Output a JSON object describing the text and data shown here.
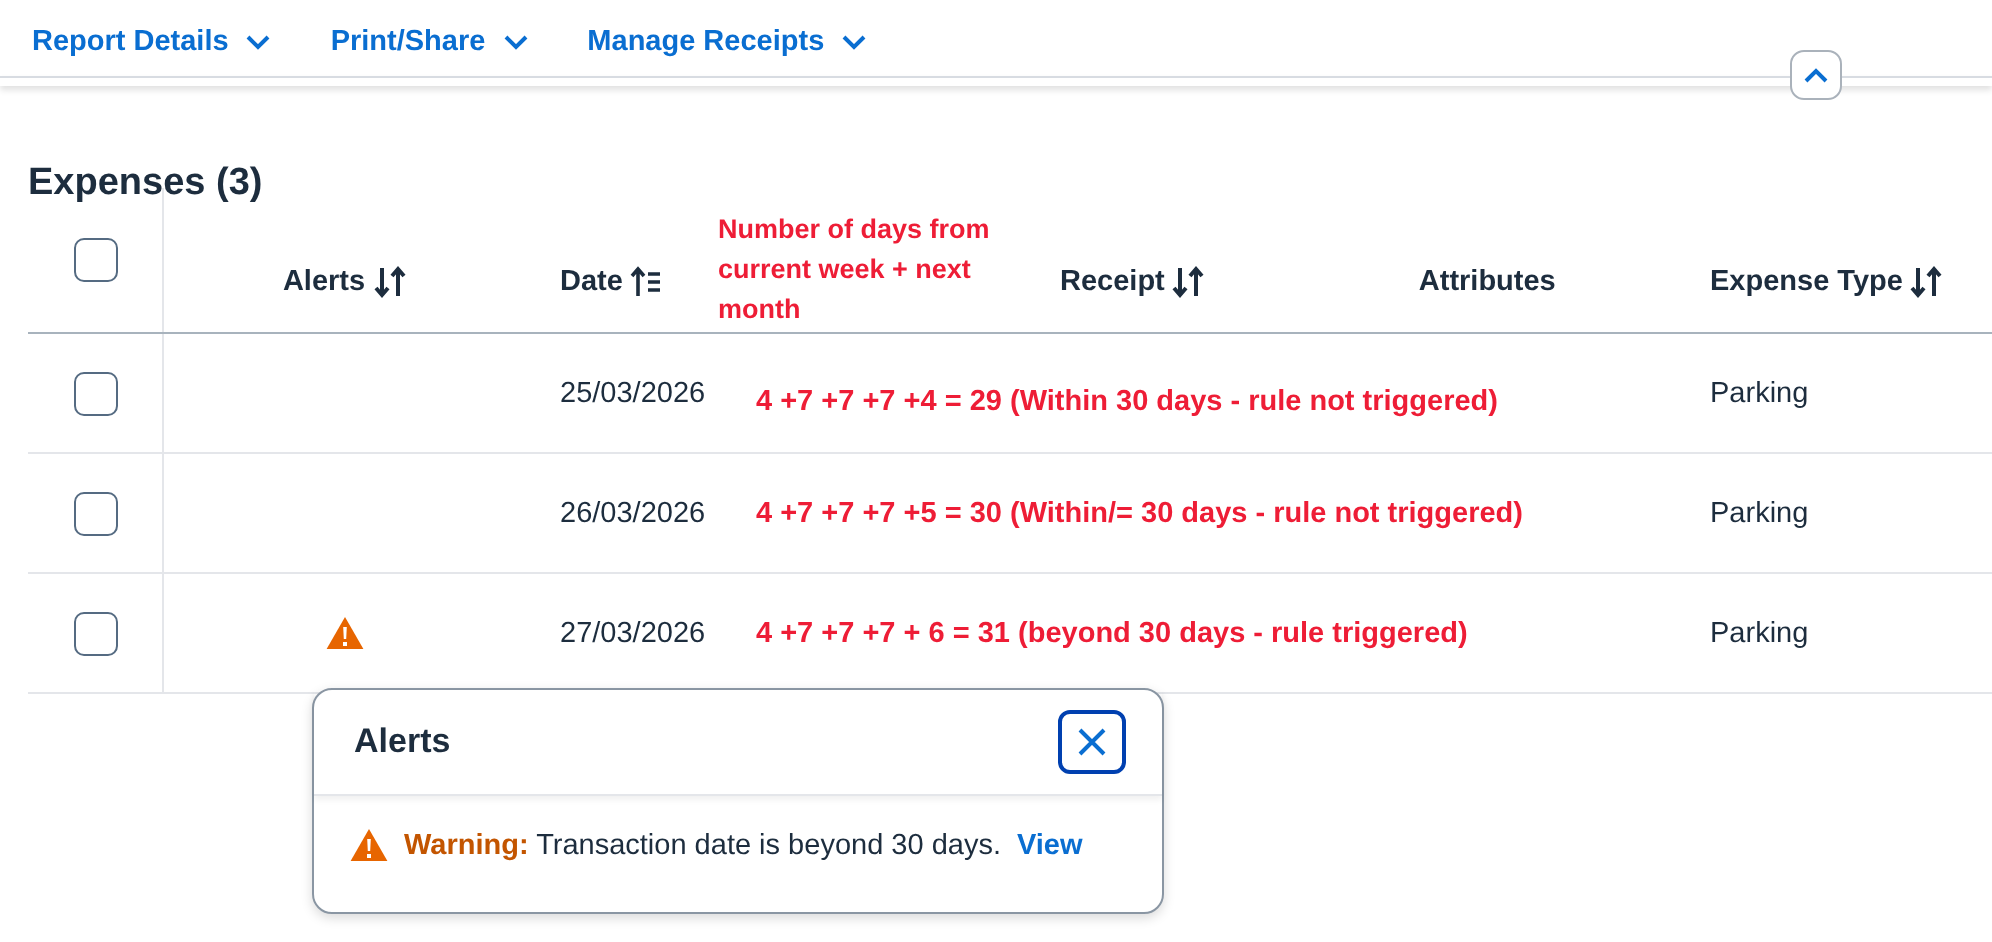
{
  "nav": [
    {
      "label": "Report Details"
    },
    {
      "label": "Print/Share"
    },
    {
      "label": "Manage Receipts"
    }
  ],
  "section": {
    "title": "Expenses (3)"
  },
  "table": {
    "header_checked": false,
    "columns": [
      {
        "label": "Alerts",
        "sortable": true,
        "sorted": false
      },
      {
        "label": "Date",
        "sortable": true,
        "sorted": true
      },
      {
        "label": "Receipt",
        "sortable": true,
        "sorted": false
      },
      {
        "label": "Attributes",
        "sortable": false
      },
      {
        "label": "Expense Type",
        "sortable": true,
        "sorted": false
      }
    ],
    "rows": [
      {
        "checked": false,
        "has_warning": false,
        "date": "25/03/2026",
        "note": "4 +7 +7 +7 +4 = 29 (Within 30 days - rule not triggered)",
        "expense_type": "Parking"
      },
      {
        "checked": false,
        "has_warning": false,
        "date": "26/03/2026",
        "note": "4 +7 +7 +7 +5 = 30 (Within/= 30 days - rule not triggered)",
        "expense_type": "Parking"
      },
      {
        "checked": false,
        "has_warning": true,
        "date": "27/03/2026",
        "note": "4 +7 +7 +7 + 6 = 31 (beyond 30 days - rule triggered)",
        "expense_type": "Parking"
      }
    ]
  },
  "annotation": "Number of days from current week + next month",
  "popup": {
    "title": "Alerts",
    "items": [
      {
        "kind": "warning",
        "label": "Warning:",
        "message": "Transaction date is beyond 30 days.",
        "link": "View"
      }
    ]
  }
}
